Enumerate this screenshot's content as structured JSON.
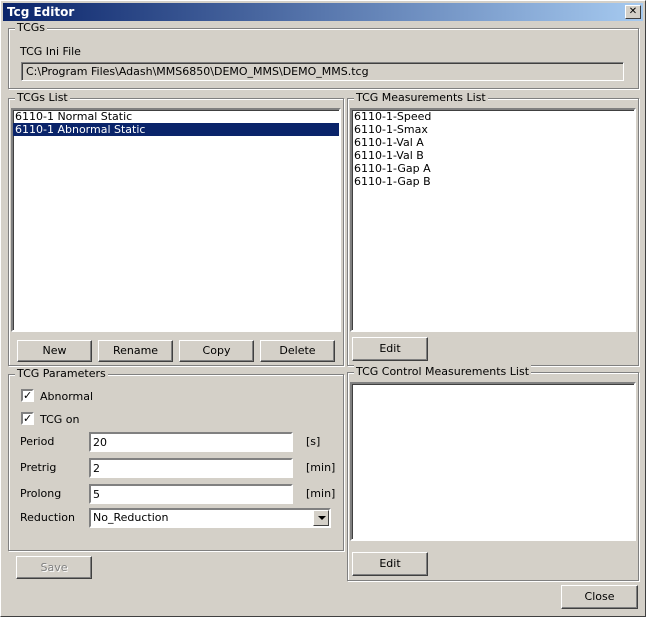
{
  "window": {
    "title": "Tcg Editor",
    "close_glyph": "✕"
  },
  "tcgs": {
    "group_label": "TCGs",
    "ini_file_label": "TCG Ini File",
    "ini_file_path": "C:\\Program Files\\Adash\\MMS6850\\DEMO_MMS\\DEMO_MMS.tcg"
  },
  "tcgs_list": {
    "group_label": "TCGs List",
    "items": [
      {
        "label": "6110-1 Normal Static",
        "selected": false
      },
      {
        "label": "6110-1 Abnormal Static",
        "selected": true
      }
    ],
    "buttons": {
      "new": "New",
      "rename": "Rename",
      "copy": "Copy",
      "delete": "Delete"
    }
  },
  "measurements_list": {
    "group_label": "TCG Measurements List",
    "items": [
      "6110-1-Speed",
      "6110-1-Smax",
      "6110-1-Val A",
      "6110-1-Val B",
      "6110-1-Gap A",
      "6110-1-Gap B"
    ],
    "edit_label": "Edit"
  },
  "control_list": {
    "group_label": "TCG Control Measurements List",
    "items": [],
    "edit_label": "Edit"
  },
  "parameters": {
    "group_label": "TCG Parameters",
    "abnormal": {
      "label": "Abnormal",
      "checked": true
    },
    "tcg_on": {
      "label": "TCG on",
      "checked": true
    },
    "period": {
      "label": "Period",
      "value": "20",
      "unit": "[s]"
    },
    "pretrig": {
      "label": "Pretrig",
      "value": "2",
      "unit": "[min]"
    },
    "prolong": {
      "label": "Prolong",
      "value": "5",
      "unit": "[min]"
    },
    "reduction": {
      "label": "Reduction",
      "value": "No_Reduction"
    }
  },
  "footer": {
    "save_label": "Save",
    "close_label": "Close"
  },
  "check_glyph": "✓"
}
